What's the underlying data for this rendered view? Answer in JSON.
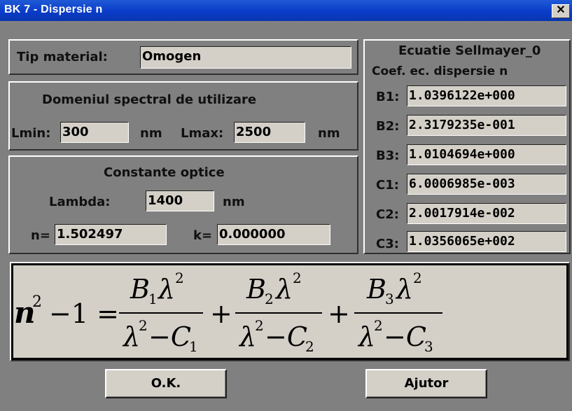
{
  "window": {
    "title": "BK 7 - Dispersie n",
    "close_glyph": "✕"
  },
  "material": {
    "label": "Tip material:",
    "value": "Omogen"
  },
  "spectral": {
    "heading": "Domeniul spectral de utilizare",
    "lmin_label": "Lmin:",
    "lmin_value": "300",
    "lmin_unit": "nm",
    "lmax_label": "Lmax:",
    "lmax_value": "2500",
    "lmax_unit": "nm"
  },
  "optical": {
    "heading": "Constante optice",
    "lambda_label": "Lambda:",
    "lambda_value": "1400",
    "lambda_unit": "nm",
    "n_label": "n=",
    "n_value": "1.502497",
    "k_label": "k=",
    "k_value": "0.000000"
  },
  "sellmeier": {
    "heading": "Ecuatie Sellmayer_0",
    "subheading": "Coef. ec. dispersie n",
    "coefficients": [
      {
        "label": "B1:",
        "value": "1.0396122e+000"
      },
      {
        "label": "B2:",
        "value": "2.3179235e-001"
      },
      {
        "label": "B3:",
        "value": "1.0104694e+000"
      },
      {
        "label": "C1:",
        "value": "6.0006985e-003"
      },
      {
        "label": "C2:",
        "value": "2.0017914e-002"
      },
      {
        "label": "C3:",
        "value": "1.0356065e+002"
      }
    ]
  },
  "formula": {
    "lhs_n": "n",
    "lhs_exp": "2",
    "lhs_rest": "−1 =",
    "B": "B",
    "lambda": "λ",
    "sq": "2",
    "minus_C": "−C",
    "idx1": "1",
    "idx2": "2",
    "idx3": "3",
    "plus": "+"
  },
  "buttons": {
    "ok": "O.K.",
    "help": "Ajutor"
  }
}
